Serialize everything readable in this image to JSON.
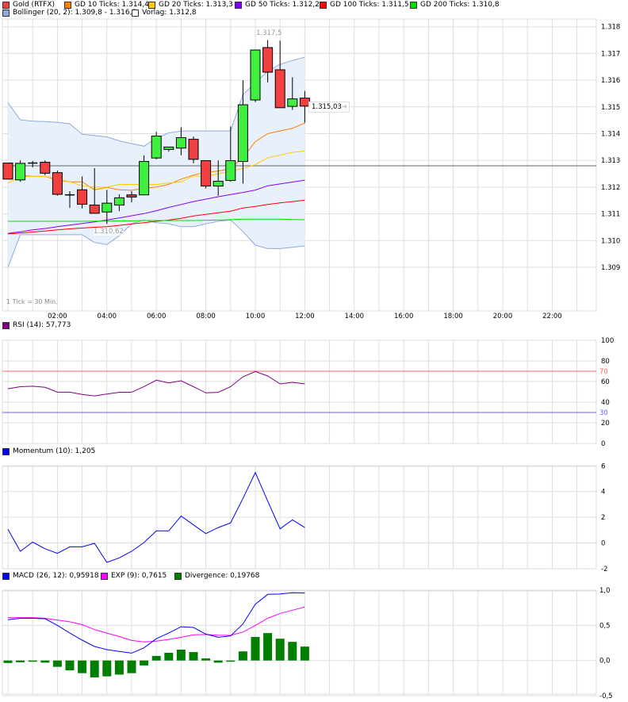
{
  "legend_main": [
    {
      "label": "Gold (RTFX)",
      "color": "#f04040"
    },
    {
      "label": "GD 10 Ticks: 1.314,4",
      "color": "#ff7f00"
    },
    {
      "label": "GD 20 Ticks: 1.313,3",
      "color": "#ffcc00"
    },
    {
      "label": "GD 50 Ticks: 1.312,2",
      "color": "#8000ff"
    },
    {
      "label": "GD 100 Ticks: 1.311,5",
      "color": "#ff0000"
    },
    {
      "label": "GD 200 Ticks: 1.310,8",
      "color": "#00dd00"
    },
    {
      "label": "Bollinger (20, 2): 1.309,8 - 1.316,8",
      "color": "#8faadc"
    },
    {
      "label": "Vorlag: 1.312,8",
      "color": "#ffffff"
    }
  ],
  "tick_note": "1 Tick = 30 Min.",
  "high_label": "1.317,5",
  "low_label": "1.310,62",
  "last_label": "1.315,03",
  "rsi_legend": {
    "label": "RSI (14): 57,773",
    "color": "#800080"
  },
  "momentum_legend": {
    "label": "Momentum (10): 1,205",
    "color": "#0000ff"
  },
  "macd_legend": [
    {
      "label": "MACD (26, 12): 0,95918",
      "color": "#0000ff"
    },
    {
      "label": "EXP (9): 0,7615",
      "color": "#ff00ff"
    },
    {
      "label": "Divergence: 0,19768",
      "color": "#008000"
    }
  ],
  "chart_data": [
    {
      "type": "candlestick",
      "title": "Gold (RTFX)",
      "x_ticks": [
        "02:00",
        "04:00",
        "06:00",
        "08:00",
        "10:00",
        "12:00",
        "14:00",
        "16:00",
        "18:00",
        "20:00",
        "22:00"
      ],
      "y_ticks": [
        "1.318",
        "1.317",
        "1.316",
        "1.315",
        "1.314",
        "1.313",
        "1.312",
        "1.311",
        "1.310",
        "1.309"
      ],
      "ylim": [
        1.3085,
        1.3183
      ],
      "xlim_hours": [
        0,
        24
      ],
      "grid": true,
      "x": [
        "00:00",
        "00:30",
        "01:00",
        "01:30",
        "02:00",
        "02:30",
        "03:00",
        "03:30",
        "04:00",
        "04:30",
        "05:00",
        "05:30",
        "06:00",
        "06:30",
        "07:00",
        "07:30",
        "08:00",
        "08:30",
        "09:00",
        "09:30",
        "10:00",
        "10:30",
        "11:00",
        "11:30",
        "12:00"
      ],
      "ohlc": [
        [
          1.3129,
          1.3129,
          1.3123,
          1.3123
        ],
        [
          1.31227,
          1.313,
          1.3122,
          1.31289
        ],
        [
          1.3129,
          1.31298,
          1.31274,
          1.3129
        ],
        [
          1.31293,
          1.313,
          1.31245,
          1.31252
        ],
        [
          1.31254,
          1.31262,
          1.31168,
          1.31173
        ],
        [
          1.31171,
          1.31185,
          1.31123,
          1.31171
        ],
        [
          1.3119,
          1.3124,
          1.3112,
          1.31136
        ],
        [
          1.31133,
          1.31271,
          1.31102,
          1.31102
        ],
        [
          1.31107,
          1.3119,
          1.31062,
          1.3114
        ],
        [
          1.31133,
          1.31173,
          1.3111,
          1.3116
        ],
        [
          1.31171,
          1.31185,
          1.31143,
          1.31163
        ],
        [
          1.31171,
          1.31319,
          1.31171,
          1.31296
        ],
        [
          1.31309,
          1.31407,
          1.31304,
          1.31391
        ],
        [
          1.31341,
          1.3135,
          1.31333,
          1.3135
        ],
        [
          1.31346,
          1.31424,
          1.31319,
          1.31385
        ],
        [
          1.31379,
          1.31389,
          1.31289,
          1.31304
        ],
        [
          1.31299,
          1.31299,
          1.31195,
          1.31204
        ],
        [
          1.31204,
          1.313,
          1.31168,
          1.31222
        ],
        [
          1.31225,
          1.31427,
          1.3122,
          1.31299
        ],
        [
          1.31296,
          1.316,
          1.31213,
          1.31508
        ],
        [
          1.31526,
          1.31713,
          1.31518,
          1.31713
        ],
        [
          1.31722,
          1.3175,
          1.31592,
          1.3163
        ],
        [
          1.31639,
          1.31748,
          1.31497,
          1.31497
        ],
        [
          1.31502,
          1.31611,
          1.31489,
          1.3153
        ],
        [
          1.31533,
          1.3156,
          1.31441,
          1.31503
        ]
      ],
      "previous_close": 1.3128,
      "series": [
        {
          "name": "GD 10 Ticks",
          "color": "#ff7f00",
          "start": 1,
          "values": [
            1.31245,
            1.3124,
            1.3124,
            1.31226,
            1.3122,
            1.3122,
            1.3119,
            1.31199,
            1.3119,
            1.31188,
            1.31196,
            1.312,
            1.3121,
            1.3123,
            1.31245,
            1.31256,
            1.3126,
            1.3127,
            1.3131,
            1.3137,
            1.314,
            1.3141,
            1.3142,
            1.3144
          ]
        },
        {
          "name": "GD 20 Ticks",
          "color": "#ffcc00",
          "start": 0,
          "values": [
            1.31215,
            1.3124,
            1.3124,
            1.3124,
            1.3123,
            1.3122,
            1.31205,
            1.312,
            1.312,
            1.3121,
            1.3121,
            1.3121,
            1.3121,
            1.31215,
            1.3122,
            1.31242,
            1.3124,
            1.3125,
            1.3126,
            1.3127,
            1.31284,
            1.3131,
            1.3132,
            1.3133,
            1.31335
          ]
        },
        {
          "name": "GD 50 Ticks",
          "color": "#8000ff",
          "start": 0,
          "values": [
            1.31027,
            1.31033,
            1.3104,
            1.31045,
            1.31052,
            1.31058,
            1.31064,
            1.3107,
            1.31077,
            1.31085,
            1.31093,
            1.31101,
            1.31112,
            1.31124,
            1.31135,
            1.31146,
            1.31155,
            1.31164,
            1.31172,
            1.3118,
            1.31189,
            1.31205,
            1.31212,
            1.31219,
            1.31226
          ]
        },
        {
          "name": "GD 100 Ticks",
          "color": "#ff0000",
          "start": 0,
          "values": [
            1.31025,
            1.31028,
            1.31032,
            1.31036,
            1.3104,
            1.31044,
            1.31047,
            1.3105,
            1.31052,
            1.31057,
            1.31062,
            1.31067,
            1.31072,
            1.31077,
            1.31083,
            1.31092,
            1.31098,
            1.31104,
            1.3111,
            1.31122,
            1.31128,
            1.31135,
            1.31141,
            1.31146,
            1.31151
          ]
        },
        {
          "name": "GD 200 Ticks",
          "color": "#00dd00",
          "start": 0,
          "values": [
            1.31072,
            1.31072,
            1.31072,
            1.31072,
            1.31072,
            1.31072,
            1.31072,
            1.31073,
            1.31073,
            1.31074,
            1.31074,
            1.31075,
            1.31075,
            1.31075,
            1.31075,
            1.31075,
            1.31076,
            1.31077,
            1.31078,
            1.3108,
            1.3108,
            1.3108,
            1.3108,
            1.31079,
            1.31078
          ]
        },
        {
          "name": "Bollinger upper",
          "color": "#8faadc",
          "start": 0,
          "values": [
            1.31516,
            1.31452,
            1.31447,
            1.31445,
            1.31442,
            1.31437,
            1.31398,
            1.31393,
            1.31388,
            1.31373,
            1.31363,
            1.31353,
            1.31383,
            1.31403,
            1.3141,
            1.3141,
            1.3141,
            1.3141,
            1.3141,
            1.31546,
            1.3159,
            1.31634,
            1.31659,
            1.31674,
            1.31686
          ]
        },
        {
          "name": "Bollinger lower",
          "color": "#8faadc",
          "start": 0,
          "values": [
            1.309,
            1.31022,
            1.31022,
            1.31022,
            1.31022,
            1.31022,
            1.31022,
            1.30993,
            1.30985,
            1.31018,
            1.31063,
            1.31077,
            1.31067,
            1.31063,
            1.31052,
            1.31052,
            1.31063,
            1.31072,
            1.31077,
            1.31034,
            1.30983,
            1.3097,
            1.3097,
            1.30975,
            1.3098
          ]
        }
      ]
    },
    {
      "type": "line",
      "title": "RSI (14): 57,773",
      "ylim": [
        0,
        100
      ],
      "y_ticks": [
        "100",
        "80",
        "60",
        "40",
        "20",
        "0"
      ],
      "reference_lines": [
        {
          "value": 70,
          "label": "70",
          "color": "#ff6060"
        },
        {
          "value": 30,
          "label": "30",
          "color": "#6060ff"
        }
      ],
      "series": [
        {
          "name": "RSI (14)",
          "color": "#800080",
          "values": [
            53,
            55,
            55.5,
            54.4,
            49.7,
            49.7,
            47.5,
            46.1,
            47.9,
            49.5,
            49.7,
            55.1,
            61.3,
            58.7,
            60.8,
            55,
            49,
            49.5,
            55,
            64.6,
            69.7,
            65.4,
            57.7,
            59.2,
            57.8
          ]
        }
      ]
    },
    {
      "type": "line",
      "title": "Momentum (10): 1,205",
      "ylim": [
        -2,
        6
      ],
      "y_ticks": [
        "6",
        "4",
        "2",
        "0",
        "-2"
      ],
      "series": [
        {
          "name": "Momentum (10)",
          "color": "#0000ff",
          "values": [
            1.06,
            -0.65,
            0.07,
            -0.45,
            -0.81,
            -0.3,
            -0.3,
            -0.03,
            -1.51,
            -1.16,
            -0.65,
            0.03,
            0.94,
            0.94,
            2.09,
            1.41,
            0.73,
            1.2,
            1.56,
            3.47,
            5.48,
            3.26,
            1.1,
            1.8,
            1.205
          ]
        }
      ]
    },
    {
      "type": "line+bar",
      "ylim": [
        -0.5,
        1.0
      ],
      "y_ticks": [
        "1,0",
        "0,5",
        "0,0",
        "-0,5"
      ],
      "series": [
        {
          "name": "MACD (26, 12)",
          "color": "#0000ff",
          "values": [
            0.58,
            0.6,
            0.6,
            0.594,
            0.5,
            0.39,
            0.29,
            0.2,
            0.155,
            0.13,
            0.105,
            0.18,
            0.31,
            0.39,
            0.48,
            0.47,
            0.375,
            0.33,
            0.35,
            0.52,
            0.8,
            0.94,
            0.945,
            0.963,
            0.959
          ]
        },
        {
          "name": "EXP (9)",
          "color": "#ff00ff",
          "values": [
            0.61,
            0.61,
            0.61,
            0.6,
            0.575,
            0.55,
            0.51,
            0.44,
            0.39,
            0.34,
            0.285,
            0.265,
            0.275,
            0.3,
            0.33,
            0.365,
            0.37,
            0.36,
            0.357,
            0.405,
            0.5,
            0.6,
            0.67,
            0.715,
            0.7615
          ]
        },
        {
          "name": "Divergence",
          "color": "#008000",
          "type": "bar",
          "values": [
            -0.035,
            -0.025,
            -0.01,
            -0.03,
            -0.09,
            -0.14,
            -0.18,
            -0.24,
            -0.225,
            -0.2,
            -0.18,
            -0.07,
            0.065,
            0.11,
            0.155,
            0.12,
            0.03,
            -0.03,
            -0.015,
            0.13,
            0.335,
            0.39,
            0.31,
            0.265,
            0.198
          ]
        }
      ]
    }
  ]
}
